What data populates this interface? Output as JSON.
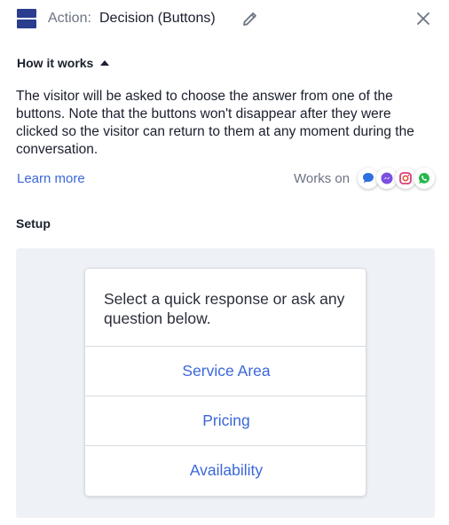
{
  "header": {
    "action_prefix": "Action:",
    "action_name": "Decision (Buttons)",
    "icons": [
      "decision-buttons-icon",
      "pencil-icon",
      "close-icon"
    ]
  },
  "how_it_works": {
    "title": "How it works",
    "description": "The visitor will be asked to choose the answer from one of the buttons. Note that the buttons won't disappear after they were clicked so the visitor can return to them at any moment during the conversation.",
    "learn_more": "Learn more",
    "works_on_label": "Works on",
    "channels": [
      "livechat-icon",
      "messenger-icon",
      "instagram-icon",
      "whatsapp-icon"
    ]
  },
  "setup": {
    "title": "Setup",
    "message": "Select a quick response or ask any question below.",
    "options": [
      "Service Area",
      "Pricing",
      "Availability"
    ]
  },
  "colors": {
    "accent": "#3b67d8",
    "icon_navy": "#2a3d8f",
    "preview_bg": "#eef1f6"
  }
}
